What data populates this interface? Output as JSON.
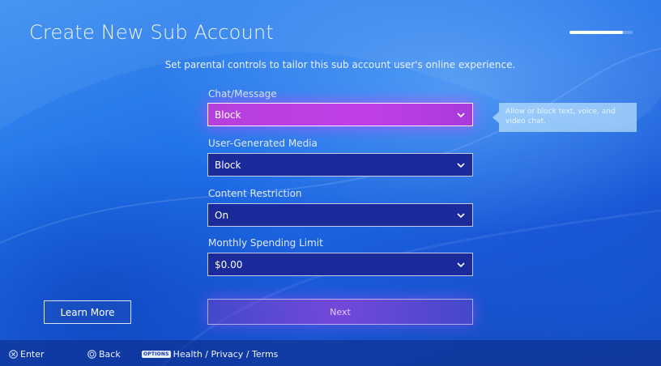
{
  "header": {
    "title": "Create New Sub Account",
    "progress_fraction": 0.85
  },
  "subtitle": "Set parental controls to tailor this sub account user's online experience.",
  "fields": [
    {
      "label": "Chat/Message",
      "value": "Block",
      "focused": true
    },
    {
      "label": "User-Generated Media",
      "value": "Block",
      "focused": false
    },
    {
      "label": "Content Restriction",
      "value": "On",
      "focused": false
    },
    {
      "label": "Monthly Spending Limit",
      "value": "$0.00",
      "focused": false
    }
  ],
  "tooltip": "Allow or block text, voice, and video chat.",
  "buttons": {
    "learn_more": "Learn More",
    "next": "Next"
  },
  "footer": {
    "enter": "Enter",
    "back": "Back",
    "options_tag": "OPTIONS",
    "options_label": "Health / Privacy / Terms"
  },
  "icons": {
    "cross": "cross-button-icon",
    "circle": "circle-button-icon",
    "chevron": "chevron-down-icon"
  },
  "colors": {
    "focus_magenta": "#c040e6",
    "select_bg": "#1b2a9a",
    "background_blue": "#1f6fe8"
  }
}
